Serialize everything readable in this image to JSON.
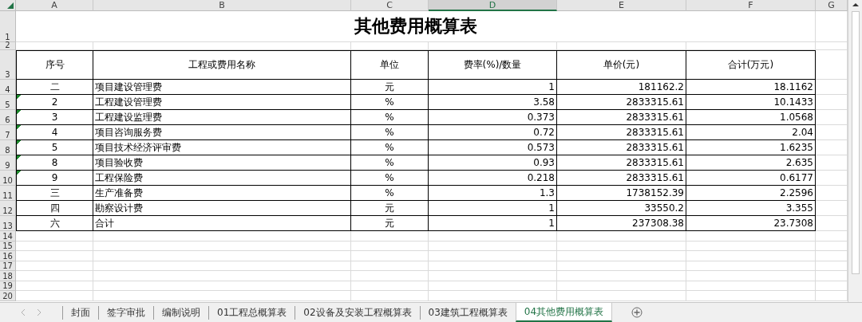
{
  "columns": [
    {
      "letter": "A",
      "selected": false
    },
    {
      "letter": "B",
      "selected": false
    },
    {
      "letter": "C",
      "selected": false
    },
    {
      "letter": "D",
      "selected": true
    },
    {
      "letter": "E",
      "selected": false
    },
    {
      "letter": "F",
      "selected": false
    },
    {
      "letter": "G",
      "selected": false
    }
  ],
  "row_numbers": [
    "1",
    "2",
    "3",
    "4",
    "5",
    "6",
    "7",
    "8",
    "9",
    "10",
    "11",
    "12",
    "13",
    "14",
    "15",
    "16",
    "17",
    "18",
    "19",
    "20"
  ],
  "title": "其他费用概算表",
  "table": {
    "columns": [
      "序号",
      "工程或费用名称",
      "单位",
      "费率(%)/数量",
      "单价(元)",
      "合计(万元)"
    ],
    "rows": [
      {
        "no": "二",
        "name": "项目建设管理费",
        "unit": "元",
        "rate": "1",
        "price": "181162.2",
        "total": "18.1162",
        "flag": false
      },
      {
        "no": "2",
        "name": "工程建设管理费",
        "unit": "%",
        "rate": "3.58",
        "price": "2833315.61",
        "total": "10.1433",
        "flag": true
      },
      {
        "no": "3",
        "name": "工程建设监理费",
        "unit": "%",
        "rate": "0.373",
        "price": "2833315.61",
        "total": "1.0568",
        "flag": true
      },
      {
        "no": "4",
        "name": "项目咨询服务费",
        "unit": "%",
        "rate": "0.72",
        "price": "2833315.61",
        "total": "2.04",
        "flag": true
      },
      {
        "no": "5",
        "name": "项目技术经济评审费",
        "unit": "%",
        "rate": "0.573",
        "price": "2833315.61",
        "total": "1.6235",
        "flag": true
      },
      {
        "no": "8",
        "name": "项目验收费",
        "unit": "%",
        "rate": "0.93",
        "price": "2833315.61",
        "total": "2.635",
        "flag": true
      },
      {
        "no": "9",
        "name": "工程保险费",
        "unit": "%",
        "rate": "0.218",
        "price": "2833315.61",
        "total": "0.6177",
        "flag": true
      },
      {
        "no": "三",
        "name": "生产准备费",
        "unit": "%",
        "rate": "1.3",
        "price": "1738152.39",
        "total": "2.2596",
        "flag": false
      },
      {
        "no": "四",
        "name": "勘察设计费",
        "unit": "元",
        "rate": "1",
        "price": "33550.2",
        "total": "3.355",
        "flag": false
      },
      {
        "no": "六",
        "name": "合计",
        "unit": "元",
        "rate": "1",
        "price": "237308.38",
        "total": "23.7308",
        "flag": false
      }
    ]
  },
  "sheet_tabs": [
    {
      "label": "封面",
      "selected": false
    },
    {
      "label": "签字审批",
      "selected": false
    },
    {
      "label": "编制说明",
      "selected": false
    },
    {
      "label": "01工程总概算表",
      "selected": false
    },
    {
      "label": "02设备及安装工程概算表",
      "selected": false
    },
    {
      "label": "03建筑工程概算表",
      "selected": false
    },
    {
      "label": "04其他费用概算表",
      "selected": true
    }
  ]
}
